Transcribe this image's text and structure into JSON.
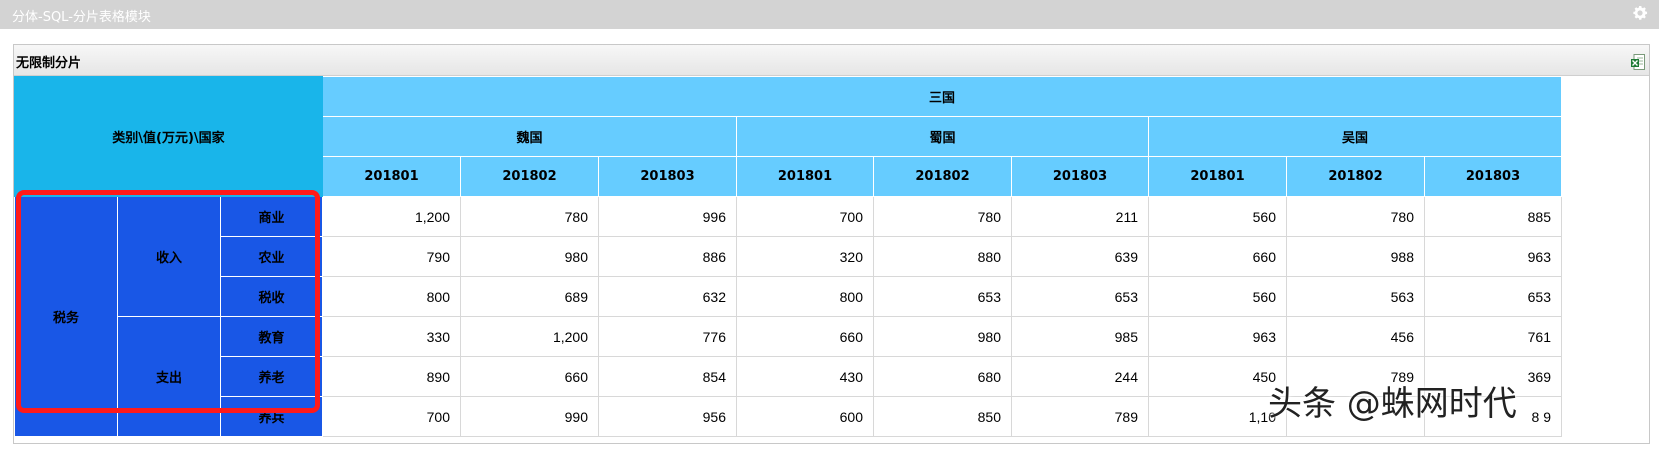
{
  "window": {
    "title": "分体-SQL-分片表格模块"
  },
  "panel": {
    "title": "无限制分片"
  },
  "table": {
    "corner_label": "类别\\值(万元)\\国家",
    "top_header": "三国",
    "countries": [
      "魏国",
      "蜀国",
      "吴国"
    ],
    "periods": [
      "201801",
      "201802",
      "201803"
    ],
    "level1": "税务",
    "groups": [
      {
        "name": "收入",
        "rows": [
          {
            "label": "商业",
            "values": [
              "1,200",
              "780",
              "996",
              "700",
              "780",
              "211",
              "560",
              "780",
              "885"
            ]
          },
          {
            "label": "农业",
            "values": [
              "790",
              "980",
              "886",
              "320",
              "880",
              "639",
              "660",
              "988",
              "963"
            ]
          },
          {
            "label": "税收",
            "values": [
              "800",
              "689",
              "632",
              "800",
              "653",
              "653",
              "560",
              "563",
              "653"
            ]
          }
        ]
      },
      {
        "name": "支出",
        "rows": [
          {
            "label": "教育",
            "values": [
              "330",
              "1,200",
              "776",
              "660",
              "980",
              "985",
              "963",
              "456",
              "761"
            ]
          },
          {
            "label": "养老",
            "values": [
              "890",
              "660",
              "854",
              "430",
              "680",
              "244",
              "450",
              "789",
              "369"
            ]
          },
          {
            "label": "养兵",
            "values": [
              "700",
              "990",
              "956",
              "600",
              "850",
              "789",
              "1,10",
              "",
              "8 9"
            ]
          }
        ]
      }
    ]
  },
  "watermark": "头条 @蛛网时代",
  "colors": {
    "corner": "#19b5ea",
    "header": "#66ccff",
    "row_header": "#1957e6",
    "highlight": "#ff1a1a",
    "titlebar": "#d3d3d3"
  },
  "icons": {
    "settings": "gear-icon",
    "export": "excel-export-icon"
  }
}
